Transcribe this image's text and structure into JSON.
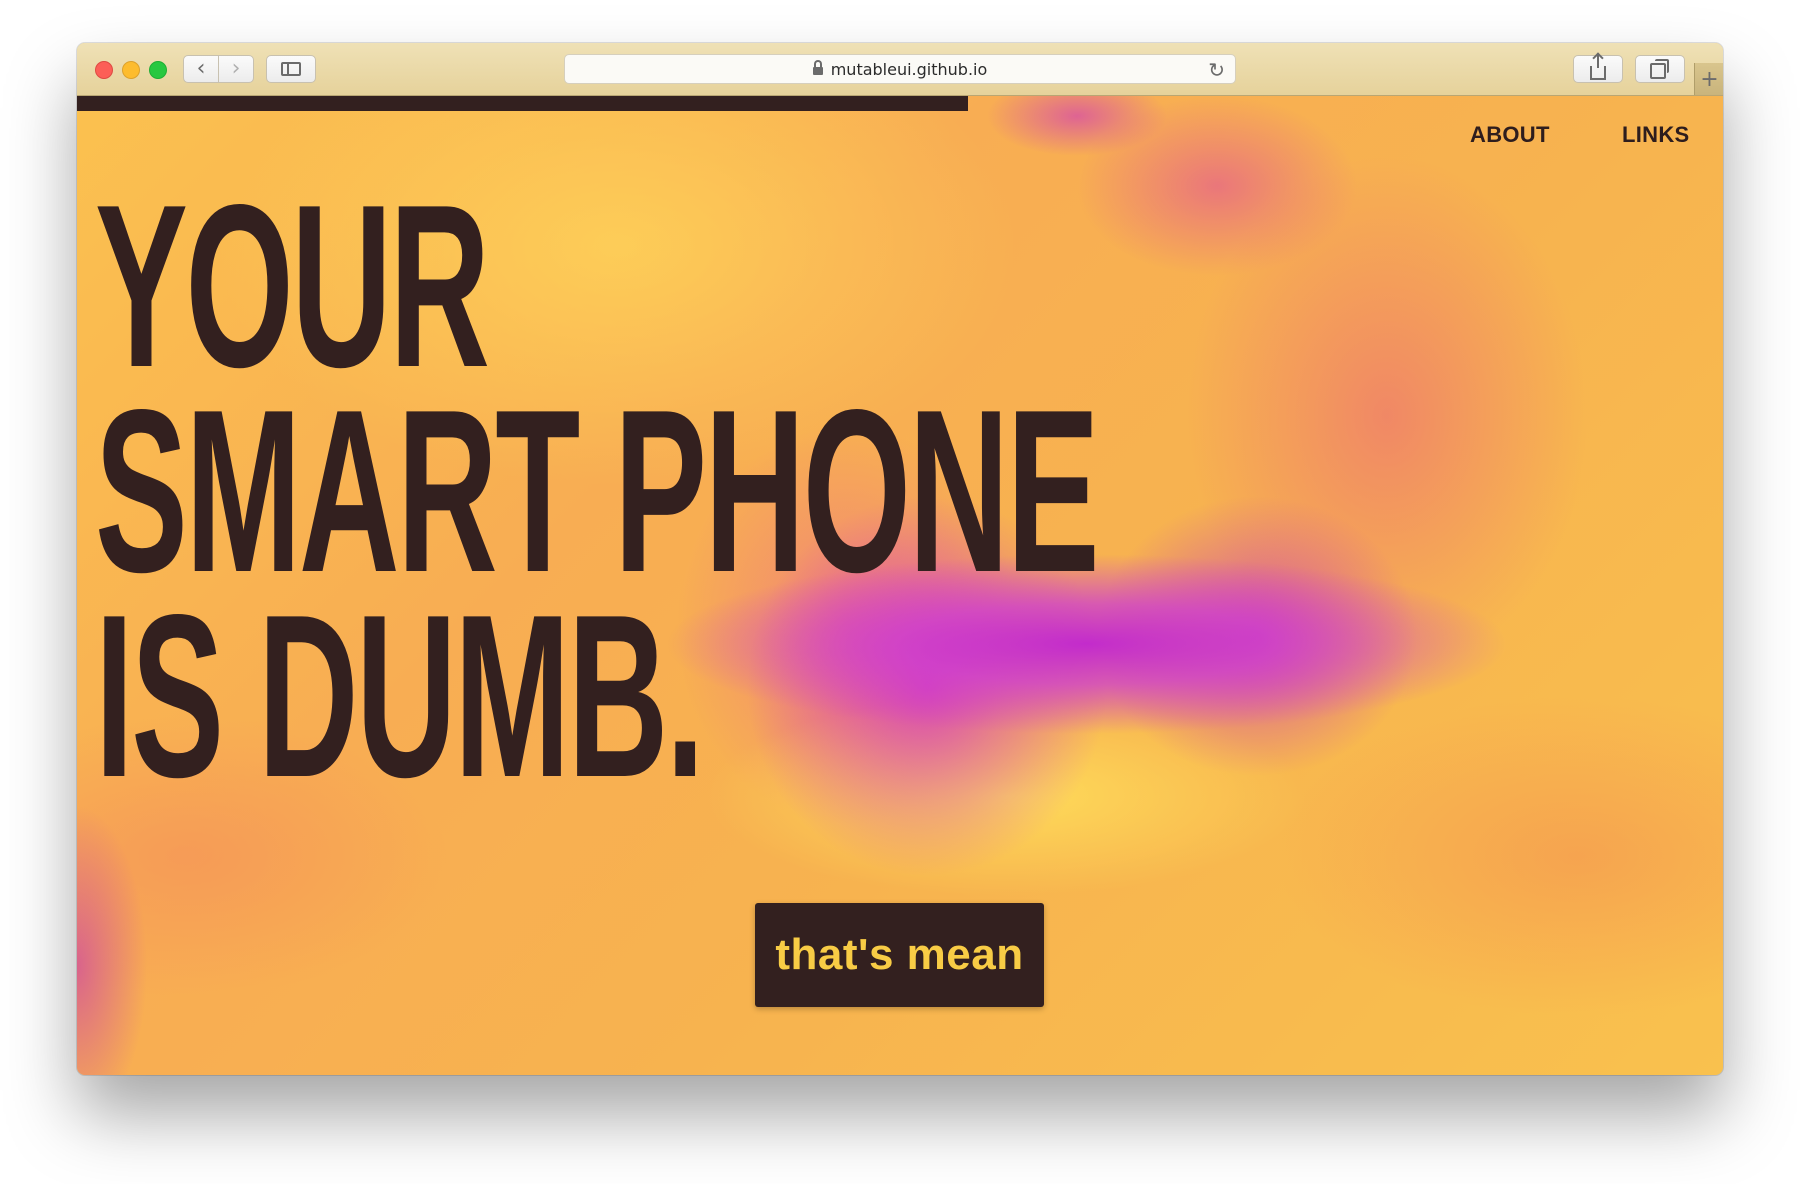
{
  "browser": {
    "url": "mutableui.github.io",
    "back_icon": "chevron-left-icon",
    "forward_icon": "chevron-right-icon",
    "reload_icon": "reload-icon",
    "new_tab_icon": "plus-icon",
    "back_glyph": "‹",
    "forward_glyph": "›",
    "reload_glyph": "↻",
    "new_tab_glyph": "+"
  },
  "page": {
    "nav": {
      "about": "ABOUT",
      "links": "LINKS"
    },
    "headline": {
      "line1": "YOUR",
      "line2": "SMART PHONE",
      "line3": "IS DUMB."
    },
    "cta_label": "that's mean",
    "colors": {
      "ink": "#33201f",
      "accent_yellow": "#f8cc45",
      "background_orange": "#f8ad53",
      "highlight_magenta": "#c024d2"
    }
  }
}
